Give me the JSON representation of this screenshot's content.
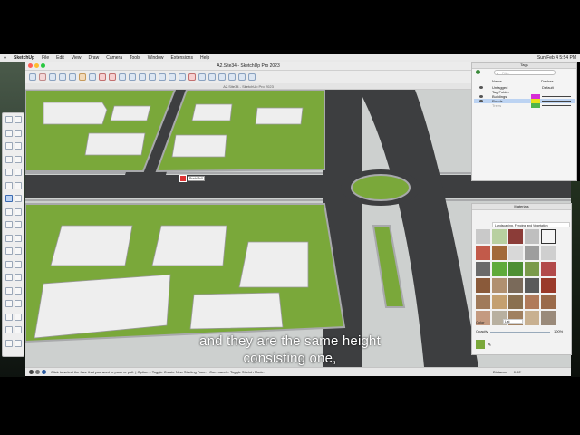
{
  "menubar": {
    "app_name": "SketchUp",
    "items": [
      "File",
      "Edit",
      "View",
      "Draw",
      "Camera",
      "Tools",
      "Window",
      "Extensions",
      "Help"
    ],
    "clock": "Sun Feb 4  5:54 PM"
  },
  "window": {
    "title": "A2.Site34 - SketchUp Pro 2023",
    "tab_title": "A2.Site34 - SketchUp Pro 2023"
  },
  "viewport": {
    "cursor_tooltip": "Push/Pull"
  },
  "tags_panel": {
    "title": "Tags",
    "search_placeholder": "Filter",
    "col_name": "Name",
    "col_dashes": "Dashes",
    "rows": [
      {
        "name": "Untagged",
        "dashes": "Default",
        "color": ""
      },
      {
        "name": "Tag Folder",
        "dashes": "",
        "color": ""
      },
      {
        "name": "Buildings",
        "dashes": "",
        "color": "#d62fd6"
      },
      {
        "name": "Roads",
        "dashes": "",
        "color": "#e8e21a"
      },
      {
        "name": "Trees",
        "dashes": "",
        "color": "#4fb54a"
      }
    ]
  },
  "materials_panel": {
    "title": "Materials",
    "category": "Landscaping, Fencing and Vegetation",
    "color_label": "Color",
    "color_dropdown": "List",
    "opacity_label": "Opacity",
    "opacity_value": "100%"
  },
  "status": {
    "message": "Click to select the face that you want to push or pull. | Option = Toggle Create New Starting Face. | Command = Toggle Stretch Mode.",
    "distance_label": "Distance",
    "distance_value": "0.00'"
  },
  "subtitle": {
    "line1": "and they are the same height",
    "line2": "consisting one,"
  },
  "colors": {
    "grass": "#7aa83a",
    "road": "#3d3e40",
    "curb": "#a8a9ab",
    "building": "#eeeeee"
  }
}
